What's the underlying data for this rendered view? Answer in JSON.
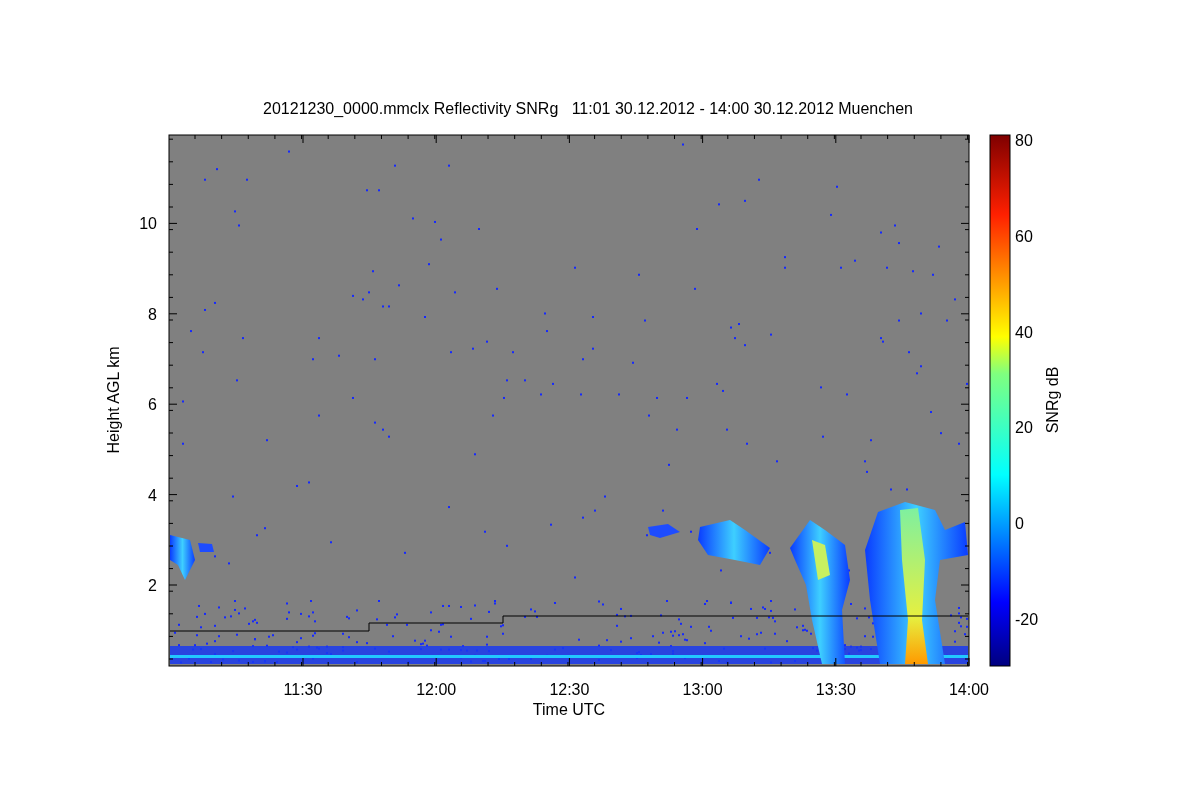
{
  "title": "20121230_0000.mmclx Reflectivity SNRg   11:01 30.12.2012 - 14:00 30.12.2012 Muenchen",
  "y_axis": {
    "label": "Height AGL km",
    "ticks": [
      "10",
      "8",
      "6",
      "4",
      "2"
    ]
  },
  "x_axis": {
    "label": "Time UTC",
    "ticks": [
      "11:30",
      "12:00",
      "12:30",
      "13:00",
      "13:30",
      "14:00"
    ]
  },
  "colorbar": {
    "label": "SNRg dB",
    "ticks": [
      "80",
      "60",
      "40",
      "20",
      "0",
      "-20"
    ]
  }
}
